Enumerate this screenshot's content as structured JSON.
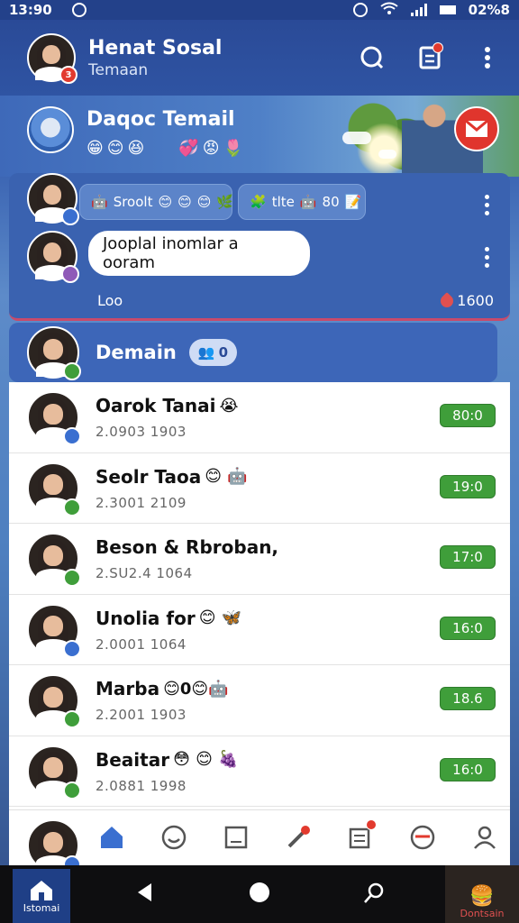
{
  "status_bar": {
    "time": "13:90",
    "battery": "02%8"
  },
  "header": {
    "title": "Henat Sosal",
    "subtitle": "Temaan"
  },
  "banner": {
    "title": "Daqoc Temail",
    "emojis": [
      "😁",
      "😊",
      "😆",
      "💞",
      "😡",
      "🌷"
    ]
  },
  "chat_card": {
    "chip1": {
      "label": "Sroolt",
      "emojis": [
        "😊",
        "😊",
        "😊",
        "🌿"
      ]
    },
    "chip2": {
      "label": "tlte",
      "emojis": [
        "🤖"
      ],
      "count": "80"
    },
    "message": "Jooplal inomlar a ooram",
    "foot_left": "Loo",
    "foot_right": "1600"
  },
  "group": {
    "title": "Demain",
    "pill_count": "0"
  },
  "contacts": [
    {
      "name": "Oarok Tanai",
      "emoji": "😭",
      "sub": "2.0903   1903",
      "time": "80:0",
      "badge": "blue"
    },
    {
      "name": "Seolr Taoa",
      "emoji": "😊 🤖",
      "sub": "2.3001   2109",
      "time": "19:0",
      "badge": "green"
    },
    {
      "name": "Beson & Rbroban,",
      "emoji": "",
      "sub": "2.SU2.4   1064",
      "time": "17:0",
      "badge": "green"
    },
    {
      "name": "Unolia for",
      "emoji": "😊 🦋",
      "sub": "2.0001   1064",
      "time": "16:0",
      "badge": "blue"
    },
    {
      "name": "Marba",
      "emoji": "😊0😊🤖",
      "sub": "2.2001   1903",
      "time": "18.6",
      "badge": "green"
    },
    {
      "name": "Beaitar",
      "emoji": "😳 😊 🍇",
      "sub": "2.0881   1998",
      "time": "16:0",
      "badge": "green"
    }
  ],
  "bottom_nav": {
    "items": [
      "home-icon",
      "smile-icon",
      "tablet-icon",
      "pen-icon",
      "notes-icon",
      "mask-icon",
      "profile-icon"
    ]
  },
  "sys_nav": {
    "left_label": "Istomai",
    "right_label": "Dontsain"
  },
  "colors": {
    "primary": "#2f54a3",
    "accent_green": "#3f9e3a",
    "accent_red": "#e23a2e"
  }
}
